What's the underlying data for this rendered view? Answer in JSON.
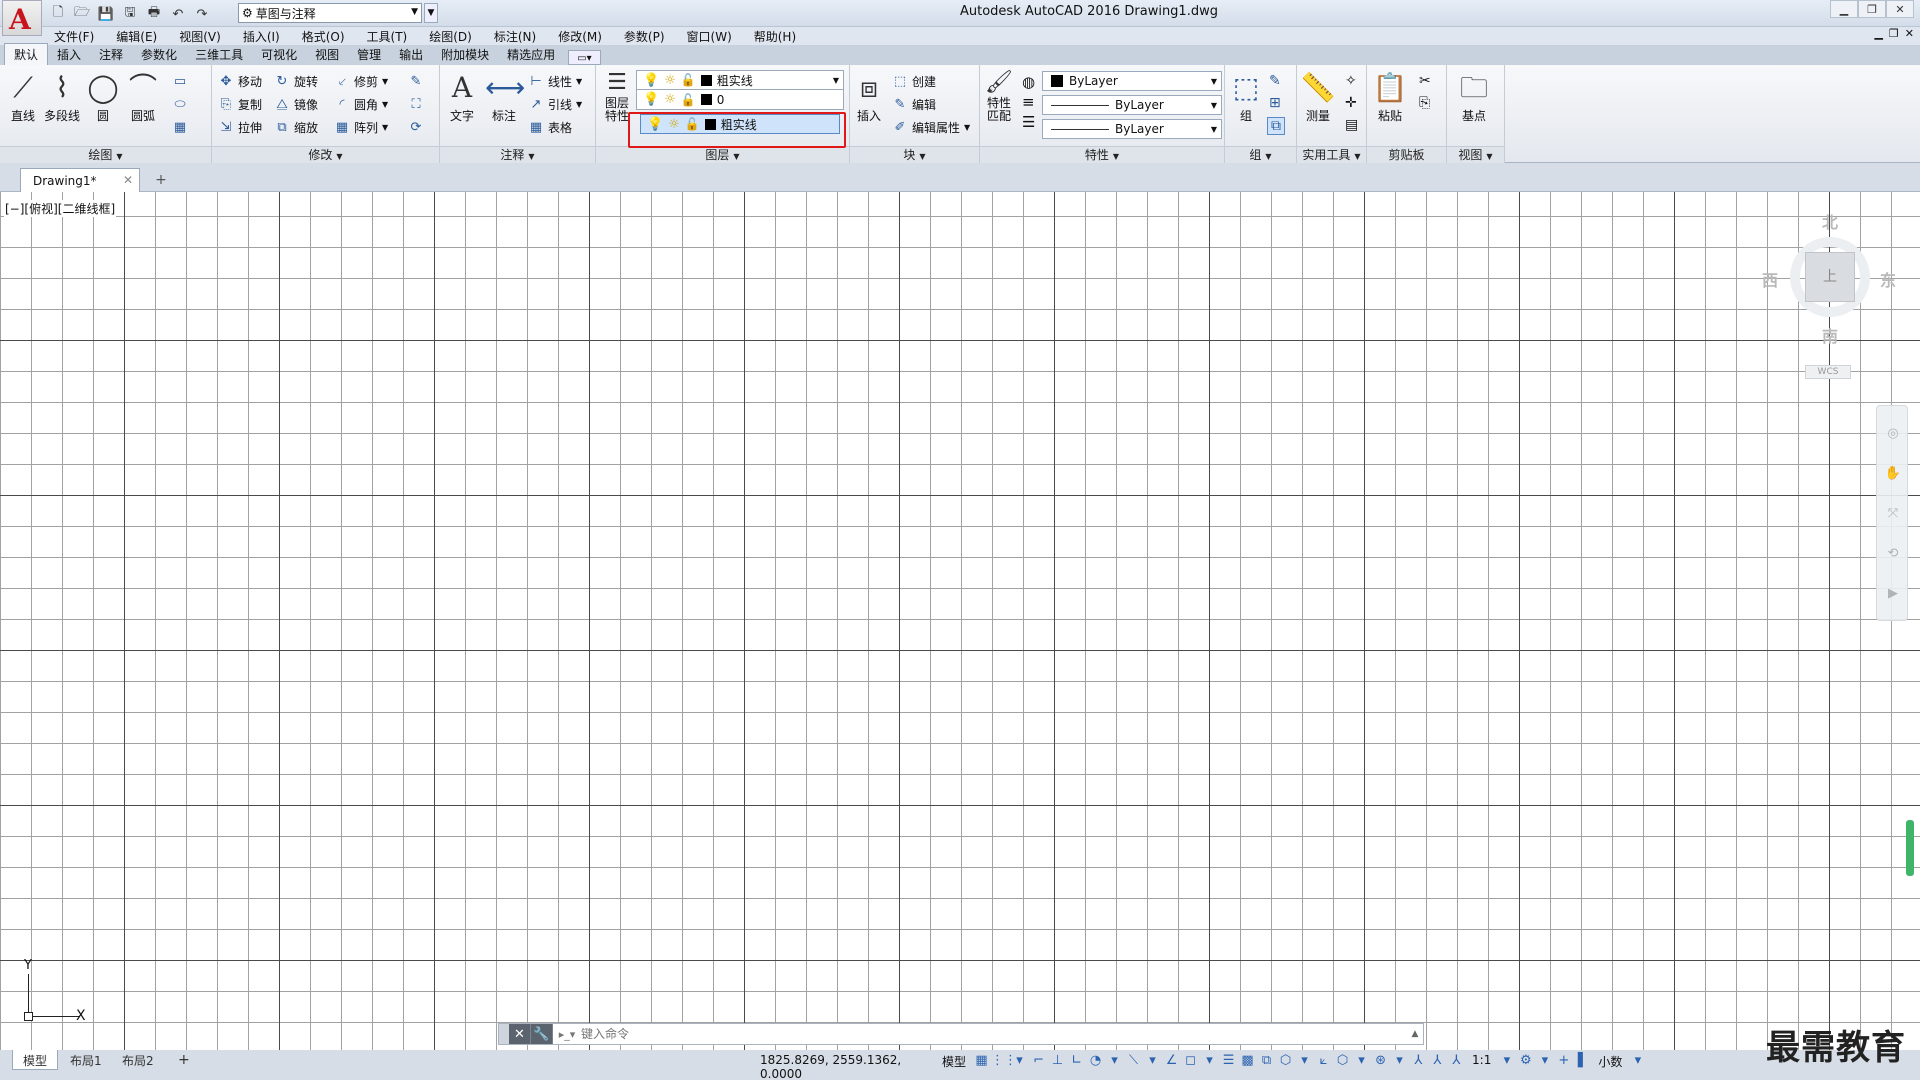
{
  "app": {
    "title": "Autodesk AutoCAD 2016    Drawing1.dwg",
    "logo_letter": "A"
  },
  "qat": {
    "workspace": "草图与注释",
    "icons": [
      "new-icon",
      "open-icon",
      "save-icon",
      "save-as-icon",
      "plot-icon",
      "undo-icon",
      "redo-icon"
    ]
  },
  "menu": [
    "文件(F)",
    "编辑(E)",
    "视图(V)",
    "插入(I)",
    "格式(O)",
    "工具(T)",
    "绘图(D)",
    "标注(N)",
    "修改(M)",
    "参数(P)",
    "窗口(W)",
    "帮助(H)"
  ],
  "ribbon_tabs": [
    "默认",
    "插入",
    "注释",
    "参数化",
    "三维工具",
    "可视化",
    "视图",
    "管理",
    "输出",
    "附加模块",
    "精选应用"
  ],
  "ribbon": {
    "draw": {
      "title": "绘图",
      "line": "直线",
      "polyline": "多段线",
      "circle": "圆",
      "arc": "圆弧"
    },
    "modify": {
      "title": "修改",
      "move": "移动",
      "rotate": "旋转",
      "trim": "修剪",
      "copy": "复制",
      "mirror": "镜像",
      "fillet": "圆角",
      "stretch": "拉伸",
      "scale": "缩放",
      "array": "阵列"
    },
    "annotation": {
      "title": "注释",
      "text": "文字",
      "dimension": "标注",
      "linear": "线性",
      "leader": "引线",
      "table": "表格"
    },
    "layers": {
      "title": "图层",
      "properties": "图层\n特性",
      "current": "粗实线",
      "list": [
        "0",
        "粗实线"
      ]
    },
    "block": {
      "title": "块",
      "insert": "插入",
      "create": "创建",
      "edit": "编辑",
      "edit_attr": "编辑属性"
    },
    "properties": {
      "title": "特性",
      "match": "特性\n匹配",
      "color": "ByLayer",
      "linetype": "ByLayer",
      "lineweight": "ByLayer"
    },
    "groups": {
      "title": "组",
      "group": "组"
    },
    "utilities": {
      "title": "实用工具",
      "measure": "测量"
    },
    "clipboard": {
      "title": "剪贴板",
      "paste": "粘贴"
    },
    "view": {
      "title": "视图",
      "base": "基点"
    }
  },
  "doc_tab": {
    "name": "Drawing1*"
  },
  "viewport_label": "[−][俯视][二维线框]",
  "viewcube": {
    "north": "北",
    "south": "南",
    "east": "东",
    "west": "西",
    "top": "上",
    "wcs": "WCS"
  },
  "ucs": {
    "x": "X",
    "y": "Y"
  },
  "command": {
    "placeholder": "键入命令"
  },
  "layout_tabs": [
    "模型",
    "布局1",
    "布局2"
  ],
  "status": {
    "coords": "1825.8269, 2559.1362, 0.0000",
    "model": "模型",
    "scale": "1:1",
    "units": "小数"
  },
  "watermark": "最需教育"
}
